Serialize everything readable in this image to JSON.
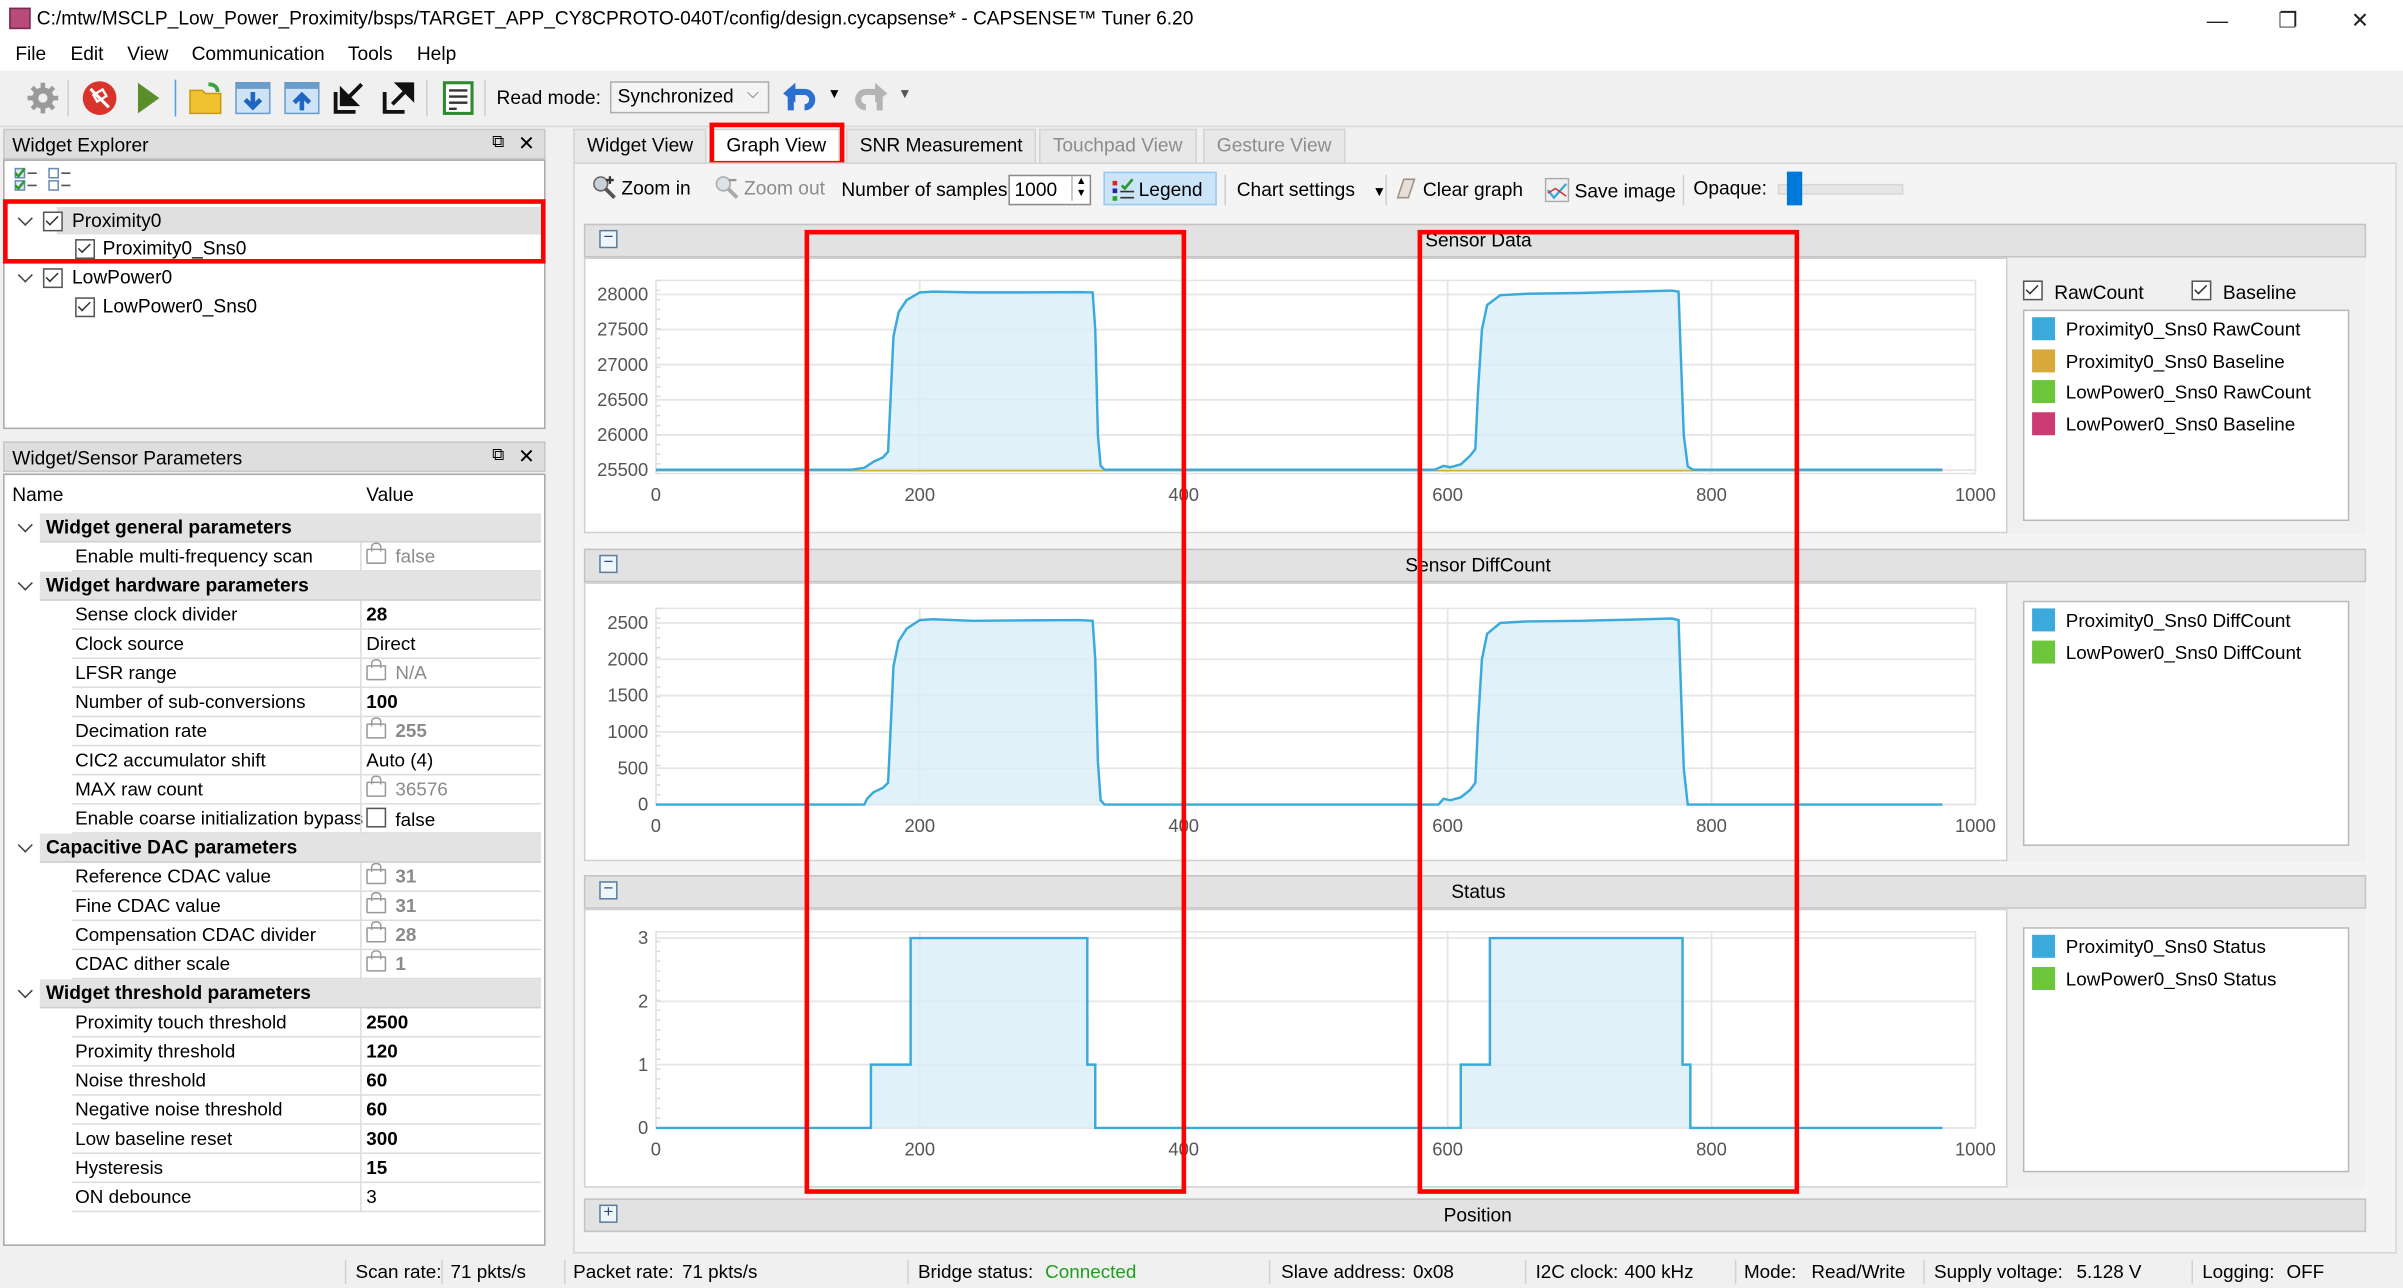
{
  "window": {
    "title": "C:/mtw/MSCLP_Low_Power_Proximity/bsps/TARGET_APP_CY8CPROTO-040T/config/design.cycapsense* - CAPSENSE™ Tuner 6.20",
    "controls": {
      "minimize": "—",
      "restore": "❐",
      "close": "✕"
    }
  },
  "menu": [
    "File",
    "Edit",
    "View",
    "Communication",
    "Tools",
    "Help"
  ],
  "toolbar": {
    "icons": [
      "gear-icon",
      "disconnect-icon",
      "start-icon",
      "open-folder-icon",
      "read-from-device-icon",
      "write-to-device-icon",
      "import-icon",
      "export-icon",
      "log-icon"
    ],
    "read_mode_label": "Read mode:",
    "read_mode_value": "Synchronized",
    "undo_icon": "undo-icon",
    "redo_icon": "redo-icon"
  },
  "widget_explorer": {
    "title": "Widget Explorer",
    "tree": [
      {
        "label": "Proximity0",
        "checked": true,
        "children": [
          {
            "label": "Proximity0_Sns0",
            "checked": true
          }
        ]
      },
      {
        "label": "LowPower0",
        "checked": true,
        "children": [
          {
            "label": "LowPower0_Sns0",
            "checked": true
          }
        ]
      }
    ]
  },
  "params": {
    "title": "Widget/Sensor Parameters",
    "col_name": "Name",
    "col_value": "Value",
    "groups": [
      {
        "name": "Widget general parameters",
        "rows": [
          {
            "name": "Enable multi-frequency scan",
            "value": "false",
            "locked": true,
            "style": "gray"
          }
        ]
      },
      {
        "name": "Widget hardware parameters",
        "rows": [
          {
            "name": "Sense clock divider",
            "value": "28",
            "style": "bold"
          },
          {
            "name": "Clock source",
            "value": "Direct",
            "style": "normal"
          },
          {
            "name": "LFSR range",
            "value": "N/A",
            "locked": true,
            "style": "gray"
          },
          {
            "name": "Number of sub-conversions",
            "value": "100",
            "style": "bold"
          },
          {
            "name": "Decimation rate",
            "value": "255",
            "locked": true,
            "style": "graybold"
          },
          {
            "name": "CIC2 accumulator shift",
            "value": "Auto (4)",
            "style": "normal"
          },
          {
            "name": "MAX raw count",
            "value": "36576",
            "locked": true,
            "style": "gray"
          },
          {
            "name": "Enable coarse initialization bypass",
            "value": "false",
            "checkbox": true,
            "style": "normal"
          }
        ]
      },
      {
        "name": "Capacitive DAC parameters",
        "rows": [
          {
            "name": "Reference CDAC value",
            "value": "31",
            "locked": true,
            "style": "graybold"
          },
          {
            "name": "Fine CDAC value",
            "value": "31",
            "locked": true,
            "style": "graybold"
          },
          {
            "name": "Compensation CDAC divider",
            "value": "28",
            "locked": true,
            "style": "graybold"
          },
          {
            "name": "CDAC dither scale",
            "value": "1",
            "locked": true,
            "style": "graybold"
          }
        ]
      },
      {
        "name": "Widget threshold parameters",
        "rows": [
          {
            "name": "Proximity touch threshold",
            "value": "2500",
            "style": "bold"
          },
          {
            "name": "Proximity threshold",
            "value": "120",
            "style": "bold"
          },
          {
            "name": "Noise threshold",
            "value": "60",
            "style": "bold"
          },
          {
            "name": "Negative noise threshold",
            "value": "60",
            "style": "bold"
          },
          {
            "name": "Low baseline reset",
            "value": "300",
            "style": "bold"
          },
          {
            "name": "Hysteresis",
            "value": "15",
            "style": "bold"
          },
          {
            "name": "ON debounce",
            "value": "3",
            "style": "normal"
          }
        ]
      }
    ]
  },
  "tabs": [
    {
      "label": "Widget View",
      "state": "normal"
    },
    {
      "label": "Graph View",
      "state": "active"
    },
    {
      "label": "SNR Measurement",
      "state": "normal"
    },
    {
      "label": "Touchpad View",
      "state": "disabled"
    },
    {
      "label": "Gesture View",
      "state": "disabled"
    }
  ],
  "graph_toolbar": {
    "zoom_in": "Zoom in",
    "zoom_out": "Zoom out",
    "samples_label": "Number of samples:",
    "samples_value": "1000",
    "legend": "Legend",
    "chart_settings": "Chart settings",
    "clear_graph": "Clear graph",
    "save_image": "Save image",
    "opaque_label": "Opaque:",
    "opaque_level": 0.08
  },
  "sections": {
    "sensor_data": "Sensor Data",
    "diffcount": "Sensor DiffCount",
    "status": "Status",
    "position": "Position"
  },
  "legend_filters": {
    "rawcount": "RawCount",
    "baseline": "Baseline"
  },
  "colors": {
    "prox_raw": "#3aa9dc",
    "prox_baseline": "#d9a93a",
    "lp_raw": "#6cc63a",
    "lp_baseline": "#cc3a72",
    "fill": "#d8eef8",
    "connected": "#1f9d1f",
    "highlight": "#ff0000"
  },
  "chart_data": [
    {
      "type": "area",
      "title": "Sensor Data",
      "xlim": [
        0,
        1000
      ],
      "ylim": [
        25450,
        28200
      ],
      "xticks": [
        0,
        200,
        400,
        600,
        800,
        1000
      ],
      "yticks": [
        25500,
        26000,
        26500,
        27000,
        27500,
        28000
      ],
      "grid": true,
      "legend": "right",
      "series": [
        {
          "name": "Proximity0_Sns0 RawCount",
          "color": "#3aa9dc",
          "points": [
            [
              0,
              25505
            ],
            [
              148,
              25505
            ],
            [
              158,
              25530
            ],
            [
              165,
              25620
            ],
            [
              172,
              25680
            ],
            [
              176,
              25760
            ],
            [
              178,
              26600
            ],
            [
              180,
              27400
            ],
            [
              184,
              27750
            ],
            [
              190,
              27920
            ],
            [
              200,
              28030
            ],
            [
              210,
              28040
            ],
            [
              240,
              28030
            ],
            [
              280,
              28030
            ],
            [
              320,
              28035
            ],
            [
              331,
              28030
            ],
            [
              333,
              27500
            ],
            [
              335,
              26000
            ],
            [
              337,
              25560
            ],
            [
              340,
              25505
            ],
            [
              590,
              25505
            ],
            [
              597,
              25560
            ],
            [
              602,
              25540
            ],
            [
              610,
              25580
            ],
            [
              617,
              25700
            ],
            [
              621,
              25800
            ],
            [
              623,
              26600
            ],
            [
              626,
              27500
            ],
            [
              630,
              27850
            ],
            [
              640,
              27990
            ],
            [
              660,
              28010
            ],
            [
              700,
              28020
            ],
            [
              740,
              28040
            ],
            [
              770,
              28055
            ],
            [
              775,
              28040
            ],
            [
              777,
              27000
            ],
            [
              779,
              26000
            ],
            [
              782,
              25550
            ],
            [
              786,
              25505
            ],
            [
              975,
              25505
            ]
          ]
        },
        {
          "name": "Proximity0_Sns0 Baseline",
          "color": "#d9a93a",
          "points": [
            [
              0,
              25500
            ],
            [
              975,
              25500
            ]
          ]
        },
        {
          "name": "LowPower0_Sns0 RawCount",
          "color": "#6cc63a",
          "points": []
        },
        {
          "name": "LowPower0_Sns0 Baseline",
          "color": "#cc3a72",
          "points": []
        }
      ]
    },
    {
      "type": "area",
      "title": "Sensor DiffCount",
      "xlim": [
        0,
        1000
      ],
      "ylim": [
        0,
        2700
      ],
      "xticks": [
        0,
        200,
        400,
        600,
        800,
        1000
      ],
      "yticks": [
        0,
        500,
        1000,
        1500,
        2000,
        2500
      ],
      "grid": true,
      "legend": "right",
      "series": [
        {
          "name": "Proximity0_Sns0 DiffCount",
          "color": "#3aa9dc",
          "points": [
            [
              0,
              0
            ],
            [
              158,
              0
            ],
            [
              160,
              80
            ],
            [
              165,
              170
            ],
            [
              172,
              230
            ],
            [
              176,
              300
            ],
            [
              178,
              1100
            ],
            [
              180,
              1900
            ],
            [
              184,
              2250
            ],
            [
              190,
              2420
            ],
            [
              200,
              2540
            ],
            [
              210,
              2550
            ],
            [
              240,
              2530
            ],
            [
              280,
              2535
            ],
            [
              320,
              2540
            ],
            [
              331,
              2530
            ],
            [
              333,
              2000
            ],
            [
              335,
              600
            ],
            [
              337,
              60
            ],
            [
              340,
              0
            ],
            [
              593,
              0
            ],
            [
              597,
              80
            ],
            [
              602,
              60
            ],
            [
              610,
              100
            ],
            [
              617,
              200
            ],
            [
              621,
              300
            ],
            [
              623,
              1100
            ],
            [
              626,
              2000
            ],
            [
              630,
              2350
            ],
            [
              640,
              2500
            ],
            [
              660,
              2520
            ],
            [
              700,
              2530
            ],
            [
              740,
              2545
            ],
            [
              770,
              2560
            ],
            [
              775,
              2540
            ],
            [
              777,
              1500
            ],
            [
              779,
              500
            ],
            [
              782,
              0
            ],
            [
              975,
              0
            ]
          ]
        },
        {
          "name": "LowPower0_Sns0 DiffCount",
          "color": "#6cc63a",
          "points": []
        }
      ]
    },
    {
      "type": "area",
      "title": "Status",
      "xlim": [
        0,
        1000
      ],
      "ylim": [
        0,
        3.1
      ],
      "xticks": [
        0,
        200,
        400,
        600,
        800,
        1000
      ],
      "yticks": [
        0,
        1,
        2,
        3
      ],
      "grid": true,
      "legend": "right",
      "series": [
        {
          "name": "Proximity0_Sns0 Status",
          "color": "#3aa9dc",
          "points": [
            [
              0,
              0
            ],
            [
              163,
              0
            ],
            [
              163,
              1
            ],
            [
              193,
              1
            ],
            [
              193,
              3
            ],
            [
              327,
              3
            ],
            [
              327,
              1
            ],
            [
              333,
              1
            ],
            [
              333,
              0
            ],
            [
              610,
              0
            ],
            [
              610,
              1
            ],
            [
              632,
              1
            ],
            [
              632,
              3
            ],
            [
              778,
              3
            ],
            [
              778,
              1
            ],
            [
              784,
              1
            ],
            [
              784,
              0
            ],
            [
              975,
              0
            ]
          ]
        },
        {
          "name": "LowPower0_Sns0 Status",
          "color": "#6cc63a",
          "points": []
        }
      ]
    }
  ],
  "statusbar": {
    "scan_rate_label": "Scan rate:",
    "scan_rate": "71 pkts/s",
    "packet_rate_label": "Packet rate:",
    "packet_rate": "71 pkts/s",
    "bridge_label": "Bridge status:",
    "bridge": "Connected",
    "slave_label": "Slave address:",
    "slave": "0x08",
    "i2c_label": "I2C clock:",
    "i2c": "400 kHz",
    "mode_label": "Mode:",
    "mode": "Read/Write",
    "voltage_label": "Supply voltage:",
    "voltage": "5.128 V",
    "logging_label": "Logging:",
    "logging": "OFF"
  }
}
